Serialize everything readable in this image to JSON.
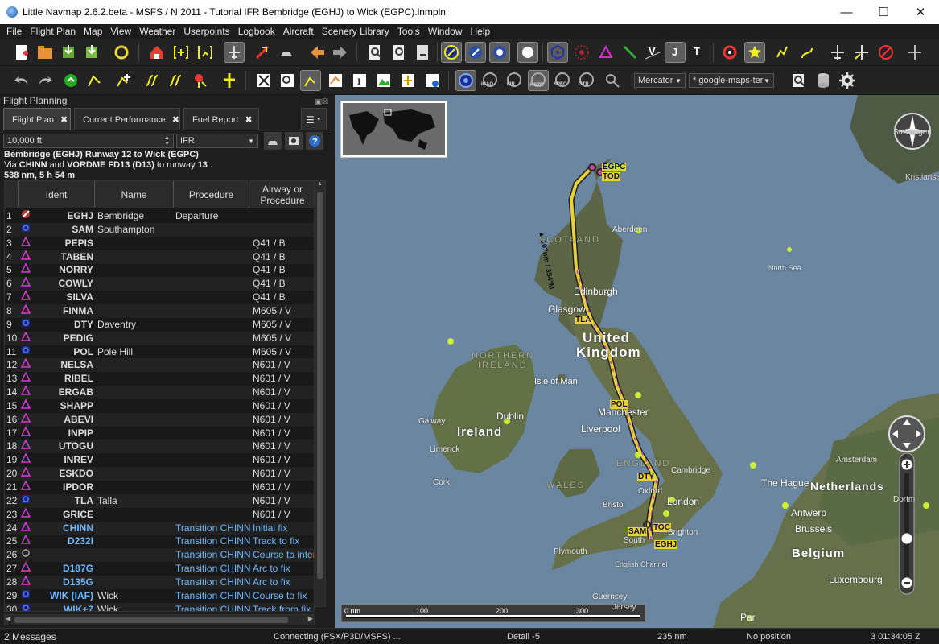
{
  "window": {
    "title": "Little Navmap 2.6.2.beta - MSFS / N 2011 - Tutorial IFR Bembridge (EGHJ) to Wick (EGPC).lnmpln"
  },
  "menu": [
    "File",
    "Flight Plan",
    "Map",
    "View",
    "Weather",
    "Userpoints",
    "Logbook",
    "Aircraft",
    "Scenery Library",
    "Tools",
    "Window",
    "Help"
  ],
  "toolbar2": {
    "btn_labels": [
      "ICAO",
      "FIR",
      "RSTR",
      "SPEC",
      "OTR"
    ],
    "projection": "Mercator",
    "theme": "* google-maps-ter"
  },
  "dock": {
    "title": "Flight Planning"
  },
  "tabs": [
    {
      "label": "Flight Plan"
    },
    {
      "label": "Current Performance"
    },
    {
      "label": "Fuel Report"
    }
  ],
  "plan": {
    "altitude": "10,000 ft",
    "type": "IFR",
    "line1": "Bembridge (EGHJ) Runway 12 to Wick (EGPC)",
    "line2_via": "Via ",
    "line2_a": "CHINN",
    "line2_and": " and ",
    "line2_b": "VORDME FD13 (D13)",
    "line2_to": " to runway ",
    "line2_rwy": "13",
    "line2_end": " .",
    "line3": "538 nm, 5 h 54 m"
  },
  "table": {
    "headers": {
      "ident": "Ident",
      "name": "Name",
      "procedure": "Procedure",
      "airway": "Airway or Procedure"
    },
    "rows": [
      {
        "n": "1",
        "icon": "airport",
        "id": "EGHJ",
        "name": "Bembridge",
        "proc": "Departure",
        "aw": ""
      },
      {
        "n": "2",
        "icon": "vor",
        "id": "SAM",
        "name": "Southampton",
        "proc": "",
        "aw": ""
      },
      {
        "n": "3",
        "icon": "wpt",
        "id": "PEPIS",
        "name": "",
        "proc": "",
        "aw": "Q41 / B"
      },
      {
        "n": "4",
        "icon": "wpt",
        "id": "TABEN",
        "name": "",
        "proc": "",
        "aw": "Q41 / B"
      },
      {
        "n": "5",
        "icon": "wpt",
        "id": "NORRY",
        "name": "",
        "proc": "",
        "aw": "Q41 / B"
      },
      {
        "n": "6",
        "icon": "wpt",
        "id": "COWLY",
        "name": "",
        "proc": "",
        "aw": "Q41 / B"
      },
      {
        "n": "7",
        "icon": "wpt",
        "id": "SILVA",
        "name": "",
        "proc": "",
        "aw": "Q41 / B"
      },
      {
        "n": "8",
        "icon": "wpt",
        "id": "FINMA",
        "name": "",
        "proc": "",
        "aw": "M605 / V"
      },
      {
        "n": "9",
        "icon": "vor",
        "id": "DTY",
        "name": "Daventry",
        "proc": "",
        "aw": "M605 / V"
      },
      {
        "n": "10",
        "icon": "wpt",
        "id": "PEDIG",
        "name": "",
        "proc": "",
        "aw": "M605 / V"
      },
      {
        "n": "11",
        "icon": "vor",
        "id": "POL",
        "name": "Pole Hill",
        "proc": "",
        "aw": "M605 / V"
      },
      {
        "n": "12",
        "icon": "wpt",
        "id": "NELSA",
        "name": "",
        "proc": "",
        "aw": "N601 / V"
      },
      {
        "n": "13",
        "icon": "wpt",
        "id": "RIBEL",
        "name": "",
        "proc": "",
        "aw": "N601 / V"
      },
      {
        "n": "14",
        "icon": "wpt",
        "id": "ERGAB",
        "name": "",
        "proc": "",
        "aw": "N601 / V"
      },
      {
        "n": "15",
        "icon": "wpt",
        "id": "SHAPP",
        "name": "",
        "proc": "",
        "aw": "N601 / V"
      },
      {
        "n": "16",
        "icon": "wpt",
        "id": "ABEVI",
        "name": "",
        "proc": "",
        "aw": "N601 / V"
      },
      {
        "n": "17",
        "icon": "wpt",
        "id": "INPIP",
        "name": "",
        "proc": "",
        "aw": "N601 / V"
      },
      {
        "n": "18",
        "icon": "wpt",
        "id": "UTOGU",
        "name": "",
        "proc": "",
        "aw": "N601 / V"
      },
      {
        "n": "19",
        "icon": "wpt",
        "id": "INREV",
        "name": "",
        "proc": "",
        "aw": "N601 / V"
      },
      {
        "n": "20",
        "icon": "wpt",
        "id": "ESKDO",
        "name": "",
        "proc": "",
        "aw": "N601 / V"
      },
      {
        "n": "21",
        "icon": "wpt",
        "id": "IPDOR",
        "name": "",
        "proc": "",
        "aw": "N601 / V"
      },
      {
        "n": "22",
        "icon": "vor",
        "id": "TLA",
        "name": "Talla",
        "proc": "",
        "aw": "N601 / V"
      },
      {
        "n": "23",
        "icon": "wpt",
        "id": "GRICE",
        "name": "",
        "proc": "",
        "aw": "N601 / V"
      },
      {
        "n": "24",
        "icon": "wpt",
        "id": "CHINN",
        "name": "",
        "proc": "Transition CHINN",
        "aw": "Initial fix",
        "p": true
      },
      {
        "n": "25",
        "icon": "wpt",
        "id": "D232I",
        "name": "",
        "proc": "Transition CHINN",
        "aw": "Track to fix",
        "p": true
      },
      {
        "n": "26",
        "icon": "circle",
        "id": "",
        "name": "",
        "proc": "Transition CHINN",
        "aw": "Course to interc",
        "p": true
      },
      {
        "n": "27",
        "icon": "wpt",
        "id": "D187G",
        "name": "",
        "proc": "Transition CHINN",
        "aw": "Arc to fix",
        "p": true
      },
      {
        "n": "28",
        "icon": "wpt",
        "id": "D135G",
        "name": "",
        "proc": "Transition CHINN",
        "aw": "Arc to fix",
        "p": true
      },
      {
        "n": "29",
        "icon": "vor",
        "id": "WIK (IAF)",
        "name": "Wick",
        "proc": "Transition CHINN",
        "aw": "Course to fix",
        "p": true
      },
      {
        "n": "30",
        "icon": "vor",
        "id": "WIK+7",
        "name": "Wick",
        "proc": "Transition CHINN",
        "aw": "Track from fix t",
        "p": true
      }
    ]
  },
  "map": {
    "labels": {
      "egpc": "EGPC",
      "tod": "TOD",
      "stavanger": "Stavanger",
      "kristiansand": "Kristiansand",
      "aberdeen": "Aberdeen",
      "scotland": "SCOTLAND",
      "north_sea": "North Sea",
      "edinburgh": "Edinburgh",
      "glasgow": "Glasgow",
      "tla": "TLA",
      "uk1": "United",
      "uk2": "Kingdom",
      "ni1": "NORTHERN",
      "ni2": "IRELAND",
      "isle_of_man": "Isle of Man",
      "pol": "POL",
      "manchester": "Manchester",
      "dublin": "Dublin",
      "galway": "Galway",
      "ireland": "Ireland",
      "liverpool": "Liverpool",
      "limerick": "Limerick",
      "cork": "Cork",
      "england": "ENGLAND",
      "dty": "DTY",
      "cambridge": "Cambridge",
      "oxford": "Oxford",
      "wales": "WALES",
      "london": "London",
      "bristol": "Bristol",
      "toc": "TOC",
      "sam": "SAM",
      "south": "South",
      "brighton": "Brighton",
      "eghj": "EGHJ",
      "plymouth": "Plymouth",
      "english_channel": "English Channel",
      "guernsey": "Guernsey",
      "jersey": "Jersey",
      "hague": "The Hague",
      "netherlands": "Netherlands",
      "amsterdam": "Amsterdam",
      "dortmund": "Dortm",
      "antwerp": "Antwerp",
      "brussels": "Brussels",
      "belgium": "Belgium",
      "luxembourg": "Luxembourg",
      "paris": "Par",
      "route_dist": "▲ 107nm / 354°M"
    },
    "scale": {
      "t0": "0 nm",
      "t1": "100",
      "t2": "200",
      "t3": "300"
    }
  },
  "status": {
    "messages": "2 Messages",
    "connection": "Connecting (FSX/P3D/MSFS) ...",
    "detail": "Detail -5",
    "distance": "235 nm",
    "position": "No position",
    "clock": "3  01:34:05 Z"
  }
}
